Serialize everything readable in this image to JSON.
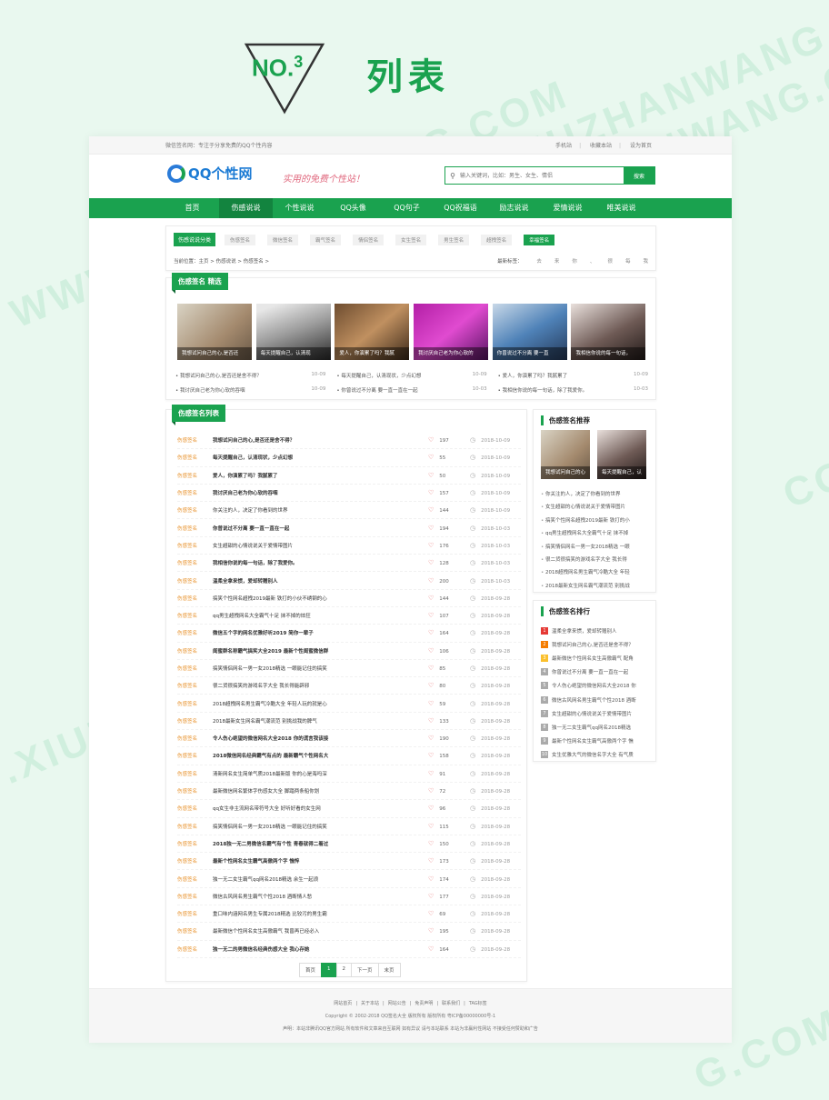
{
  "banner": {
    "no": "NO.",
    "num": "3",
    "title": "列表"
  },
  "watermarks": [
    "WWW.XIUZHANWANG.COM",
    "XIUZHANWANG.COM",
    "WWW.XIUZHANWANG.COM",
    ".XIUZ",
    "G.COM",
    "COM"
  ],
  "topbar": {
    "left": "微信签名网：专注于分享免费的QQ个性内容",
    "links": [
      "手机站",
      "收藏本站",
      "设为首页"
    ]
  },
  "header": {
    "logo": "QQ个性网",
    "slogan": "实用的免费个性站！",
    "search_placeholder": "输入关键词，比如：男生、女生、情侣",
    "search_button": "搜索"
  },
  "nav": [
    {
      "label": "首页",
      "active": false
    },
    {
      "label": "伤感说说",
      "active": true
    },
    {
      "label": "个性说说",
      "active": false
    },
    {
      "label": "QQ头像",
      "active": false
    },
    {
      "label": "QQ句子",
      "active": false
    },
    {
      "label": "QQ祝福语",
      "active": false
    },
    {
      "label": "励志说说",
      "active": false
    },
    {
      "label": "爱情说说",
      "active": false
    },
    {
      "label": "唯美说说",
      "active": false
    }
  ],
  "categories": {
    "label": "伤感说说分类",
    "tags": [
      "伤感签名",
      "微信签名",
      "霸气签名",
      "情侣签名",
      "女生签名",
      "男生签名",
      "超拽签名",
      "幸福签名"
    ],
    "active_index": 7
  },
  "crumb": {
    "text": "当前位置：主页 > 伤感说说 > 伤感签名 >",
    "latest_label": "最新标签：",
    "latest": [
      "去",
      "来",
      "你",
      "、",
      "很",
      "每",
      "我"
    ]
  },
  "picks": {
    "title": "伤感签名 精选",
    "thumbs": [
      {
        "caption": "我想试问自己的心,是否还"
      },
      {
        "caption": "每天提醒自己，认清现"
      },
      {
        "caption": "爱人，你演累了吗？我腻"
      },
      {
        "caption": "我讨厌自己老为你心软的"
      },
      {
        "caption": "你曾说过不分离 要一直"
      },
      {
        "caption": "我相信你说的每一句话，"
      }
    ],
    "list": [
      {
        "title": "我想试问自己的心,是否还是舍不得？",
        "date": "10-09"
      },
      {
        "title": "每天提醒自己，认清现状，少点幻想",
        "date": "10-09"
      },
      {
        "title": "爱人，你演累了吗？我腻累了",
        "date": "10-09"
      },
      {
        "title": "我讨厌自己老为你心软的吞咽",
        "date": "10-09"
      },
      {
        "title": "你曾说过不分离 要一直一直在一起",
        "date": "10-03"
      },
      {
        "title": "我相信你说的每一句话，除了我爱你。",
        "date": "10-03"
      }
    ]
  },
  "list": {
    "title": "伤感签名列表",
    "rows": [
      {
        "cat": "伤感签名",
        "title": "我想试问自己的心,是否还是舍不得？",
        "bold": true,
        "likes": "197",
        "date": "2018-10-09"
      },
      {
        "cat": "伤感签名",
        "title": "每天提醒自己，认清现状，少点幻想",
        "bold": true,
        "likes": "55",
        "date": "2018-10-09"
      },
      {
        "cat": "伤感签名",
        "title": "爱人，你演累了吗？我腻累了",
        "bold": true,
        "likes": "50",
        "date": "2018-10-09"
      },
      {
        "cat": "伤感签名",
        "title": "我讨厌自己老为你心软的吞咽",
        "bold": true,
        "likes": "157",
        "date": "2018-10-09"
      },
      {
        "cat": "伤感签名",
        "title": "你关注的人，决定了你看到的世界",
        "bold": false,
        "likes": "144",
        "date": "2018-10-09"
      },
      {
        "cat": "伤感签名",
        "title": "你曾说过不分离 要一直一直在一起",
        "bold": true,
        "likes": "194",
        "date": "2018-10-03"
      },
      {
        "cat": "伤感签名",
        "title": "女生超甜的心情说说关于爱情带图片",
        "bold": false,
        "likes": "176",
        "date": "2018-10-03"
      },
      {
        "cat": "伤感签名",
        "title": "我相信你说的每一句话，除了我爱你。",
        "bold": true,
        "likes": "128",
        "date": "2018-10-03"
      },
      {
        "cat": "伤感签名",
        "title": "温柔全拿来惯，爱却转赠别人",
        "bold": true,
        "likes": "200",
        "date": "2018-10-03"
      },
      {
        "cat": "伤感签名",
        "title": "搞笑个性网名超拽2019最新 铁打的小伙不绣钢的心",
        "bold": false,
        "likes": "144",
        "date": "2018-09-28"
      },
      {
        "cat": "伤感签名",
        "title": "qq男生超拽网名大全霸气十足 抹不掉的炫狂",
        "bold": false,
        "likes": "107",
        "date": "2018-09-28"
      },
      {
        "cat": "伤感签名",
        "title": "微信五个字的网名优雅好听2019 简你一辈子",
        "bold": true,
        "likes": "164",
        "date": "2018-09-28"
      },
      {
        "cat": "伤感签名",
        "title": "闺蜜群名称霸气搞笑大全2019 最新个性闺蜜微信群",
        "bold": true,
        "likes": "106",
        "date": "2018-09-28"
      },
      {
        "cat": "伤感签名",
        "title": "搞笑情侣网名一男一女2018精选 一眼能记住的搞笑",
        "bold": false,
        "likes": "85",
        "date": "2018-09-28"
      },
      {
        "cat": "伤感签名",
        "title": "很二货很搞笑的游戏名字大全 我长得能辟邪",
        "bold": false,
        "likes": "80",
        "date": "2018-09-28"
      },
      {
        "cat": "伤感签名",
        "title": "2018超拽网名男生霸气冷酷大全 年轻人玩的就是心",
        "bold": false,
        "likes": "59",
        "date": "2018-09-28"
      },
      {
        "cat": "伤感签名",
        "title": "2018最新女生网名霸气潮流范 别挑战我的脾气",
        "bold": false,
        "likes": "133",
        "date": "2018-09-28"
      },
      {
        "cat": "伤感签名",
        "title": "令人伤心绝望的微信网名大全2018 你的谎言我该接",
        "bold": true,
        "likes": "190",
        "date": "2018-09-28"
      },
      {
        "cat": "伤感签名",
        "title": "2018微信网名经典霸气有点的 最新霸气个性网名大",
        "bold": true,
        "likes": "158",
        "date": "2018-09-28"
      },
      {
        "cat": "伤感签名",
        "title": "清新网名女生简单气质2018最新版 你的心是海吗深",
        "bold": false,
        "likes": "91",
        "date": "2018-09-28"
      },
      {
        "cat": "伤感签名",
        "title": "最新微信网名繁体字伤感女大全 脚踏两条船你划",
        "bold": false,
        "likes": "72",
        "date": "2018-09-28"
      },
      {
        "cat": "伤感签名",
        "title": "qq女生非主流网名带符号大全 好听好看的女生网",
        "bold": false,
        "likes": "96",
        "date": "2018-09-28"
      },
      {
        "cat": "伤感签名",
        "title": "搞笑情侣网名一男一女2018精选 一眼能记住的搞笑",
        "bold": false,
        "likes": "115",
        "date": "2018-09-28"
      },
      {
        "cat": "伤感签名",
        "title": "2018独一无二男微信名霸气有个性 青春就得二着过",
        "bold": true,
        "likes": "150",
        "date": "2018-09-28"
      },
      {
        "cat": "伤感签名",
        "title": "最新个性网名女生霸气高傲两个字 憔悴",
        "bold": true,
        "likes": "173",
        "date": "2018-09-28"
      },
      {
        "cat": "伤感签名",
        "title": "独一无二女生霸气qq网名2018精选 余生一起浪",
        "bold": false,
        "likes": "174",
        "date": "2018-09-28"
      },
      {
        "cat": "伤感签名",
        "title": "微信古风网名男生霸气个性2018 酒断情人愁",
        "bold": false,
        "likes": "177",
        "date": "2018-09-28"
      },
      {
        "cat": "伤感签名",
        "title": "重口味内涵网名男生专属2018精选 比较污的男生霸",
        "bold": false,
        "likes": "69",
        "date": "2018-09-28"
      },
      {
        "cat": "伤感签名",
        "title": "最新微信个性网名女生高傲霸气 我曾再已经必入",
        "bold": false,
        "likes": "195",
        "date": "2018-09-28"
      },
      {
        "cat": "伤感签名",
        "title": "独一无二的男微信名经典伤感大全 我心存她",
        "bold": true,
        "likes": "164",
        "date": "2018-09-28"
      }
    ],
    "pager": [
      "首页",
      "1",
      "2",
      "下一页",
      "末页"
    ],
    "pager_current": 1
  },
  "recommend": {
    "title": "伤感签名推荐",
    "thumbs": [
      {
        "caption": "我想试问自己的心"
      },
      {
        "caption": "每天提醒自己，认"
      }
    ],
    "items": [
      "你关注的人，决定了你看到的世界",
      "女生超甜的心情说说关于爱情带图片",
      "搞笑个性网名超拽2019最新 铁打的小",
      "qq男生超拽网名大全霸气十足 抹不掉",
      "搞笑情侣网名一男一女2018精选 一眼",
      "很二货很搞笑的游戏名字大全 我长得",
      "2018超拽网名男生霸气冷酷大全 年轻",
      "2018最新女生网名霸气潮流范 别挑战"
    ]
  },
  "ranking": {
    "title": "伤感签名排行",
    "items": [
      "温柔全拿来惯，爱却转赠别人",
      "我想试问自己的心,是否还是舍不得？",
      "最新微信个性网名女生高傲霸气 配角",
      "你曾说过不分离 要一直一直在一起",
      "令人伤心绝望的微信网名大全2018 你",
      "微信古风网名男生霸气个性2018 酒断",
      "女生超甜的心情说说关于爱情带图片",
      "独一无二女生霸气qq网名2018精选",
      "最新个性网名女生霸气高傲两个字 憔",
      "女生优雅大气的微信名字大全 有气质"
    ]
  },
  "footer": {
    "links": [
      "网站首页",
      "关于本站",
      "网站公告",
      "免责声明",
      "联系我们",
      "TAG标签"
    ],
    "copyright": "Copyright © 2002-2018 QQ签名大全 版权所有 版权所有 粤ICP备00000000号-1",
    "notice": "声明：本站非腾讯QQ官方网站 所有软件和文章来自互联网 如有异议 请与本站联系 本站为非赢利性网站 不接受任何赞助和广告"
  }
}
